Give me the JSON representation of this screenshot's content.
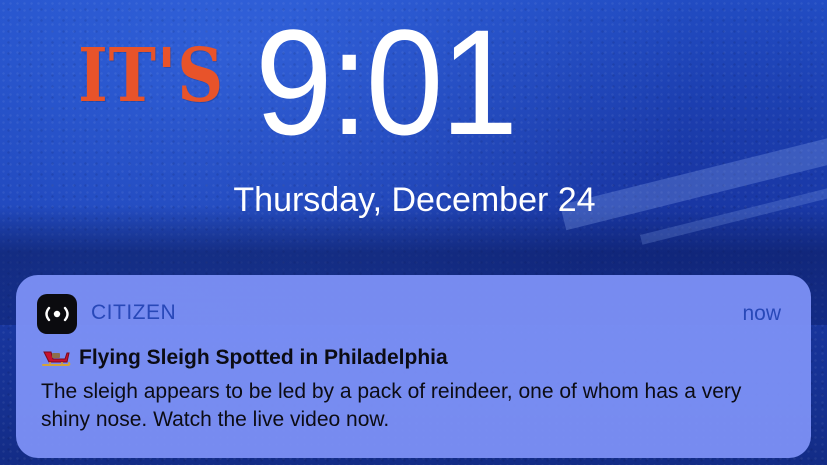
{
  "wallpaper": {
    "logo_text": "IT'S",
    "logo_color": "#e8532a"
  },
  "lock_screen": {
    "time": "9:01",
    "date": "Thursday, December 24"
  },
  "notification": {
    "app_icon": "citizen-broadcast-icon",
    "app_name": "CITIZEN",
    "time": "now",
    "title_icon": "sleigh-icon",
    "title": "Flying Sleigh Spotted in Philadelphia",
    "body": "The sleigh appears to be led by a pack of reindeer, one of whom has a very shiny nose. Watch the live video now.",
    "accent_color": "#2848b8",
    "background_color": "#7d92f7"
  }
}
